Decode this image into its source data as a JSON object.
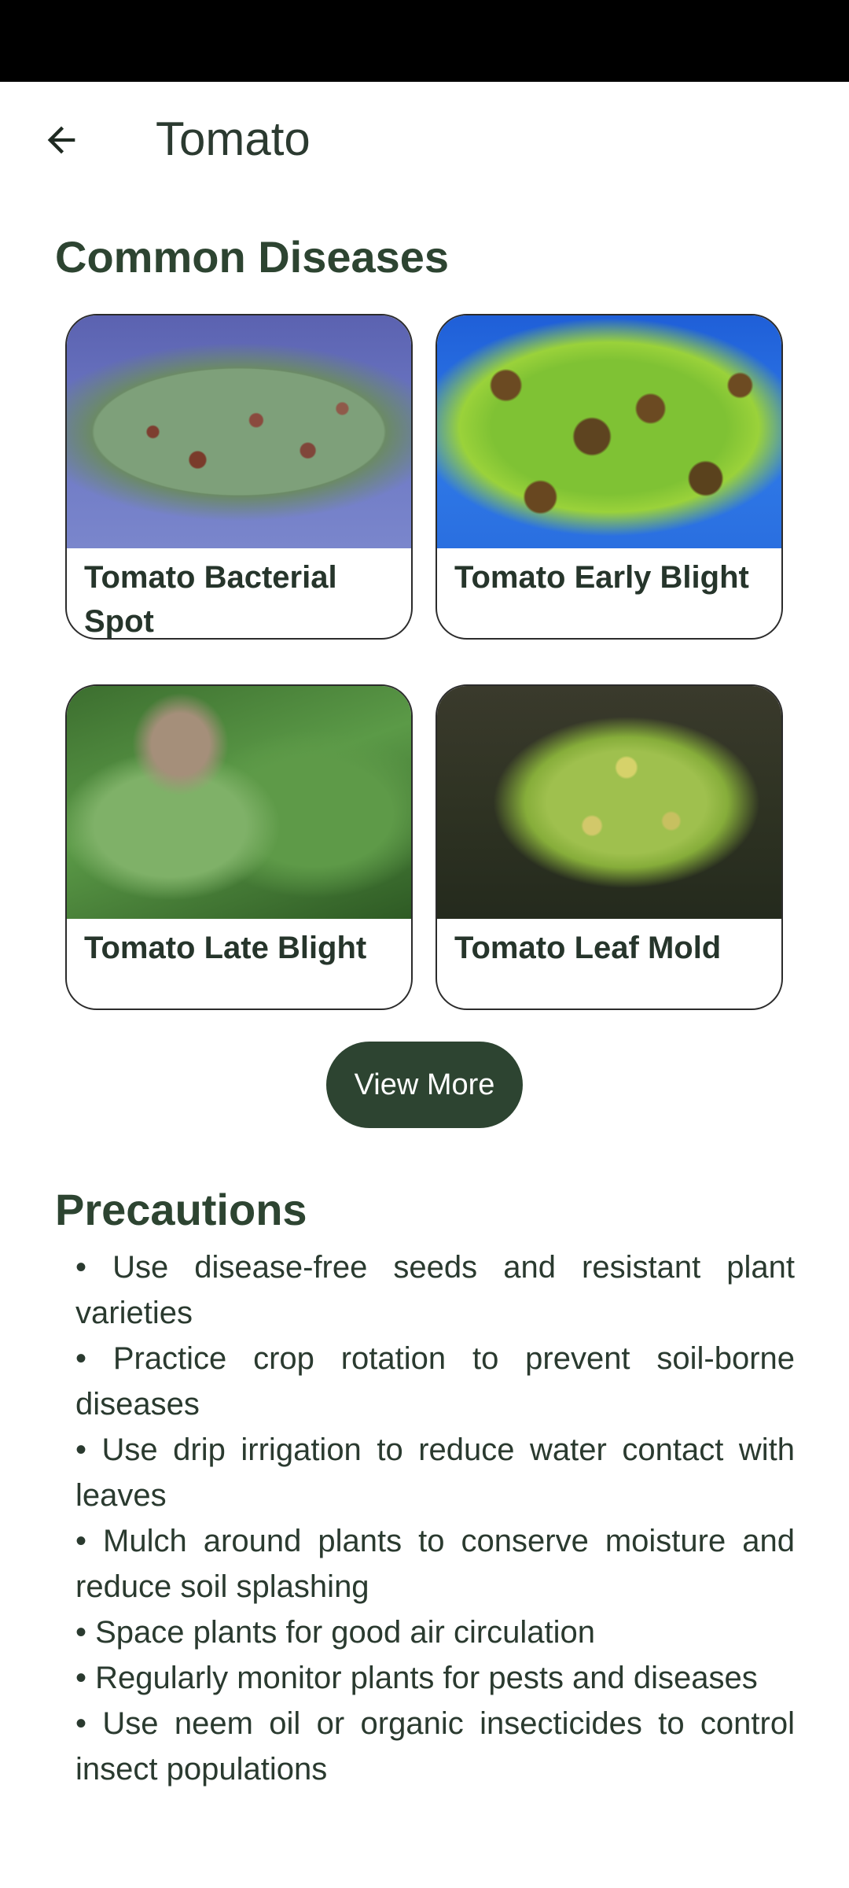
{
  "app_bar": {
    "title": "Tomato",
    "back_icon": "arrow-left-icon"
  },
  "common_diseases": {
    "title": "Common Diseases",
    "cards": [
      {
        "label": "Tomato Bacterial Spot"
      },
      {
        "label": "Tomato Early Blight"
      },
      {
        "label": "Tomato Late Blight"
      },
      {
        "label": "Tomato Leaf Mold"
      }
    ],
    "view_more_label": "View More"
  },
  "precautions": {
    "title": "Precautions",
    "items": [
      "• Use disease-free seeds and resistant plant varieties",
      "• Practice crop rotation to prevent soil-borne diseases",
      "• Use drip irrigation to reduce water contact with leaves",
      "• Mulch around plants to conserve moisture and reduce soil splashing",
      "• Space plants for good air circulation",
      "• Regularly monitor plants for pests and diseases",
      "• Use neem oil or organic insecticides to control insect populations"
    ]
  },
  "colors": {
    "primary": "#2d4431",
    "text": "#2a3a2f",
    "background": "#ffffff"
  }
}
